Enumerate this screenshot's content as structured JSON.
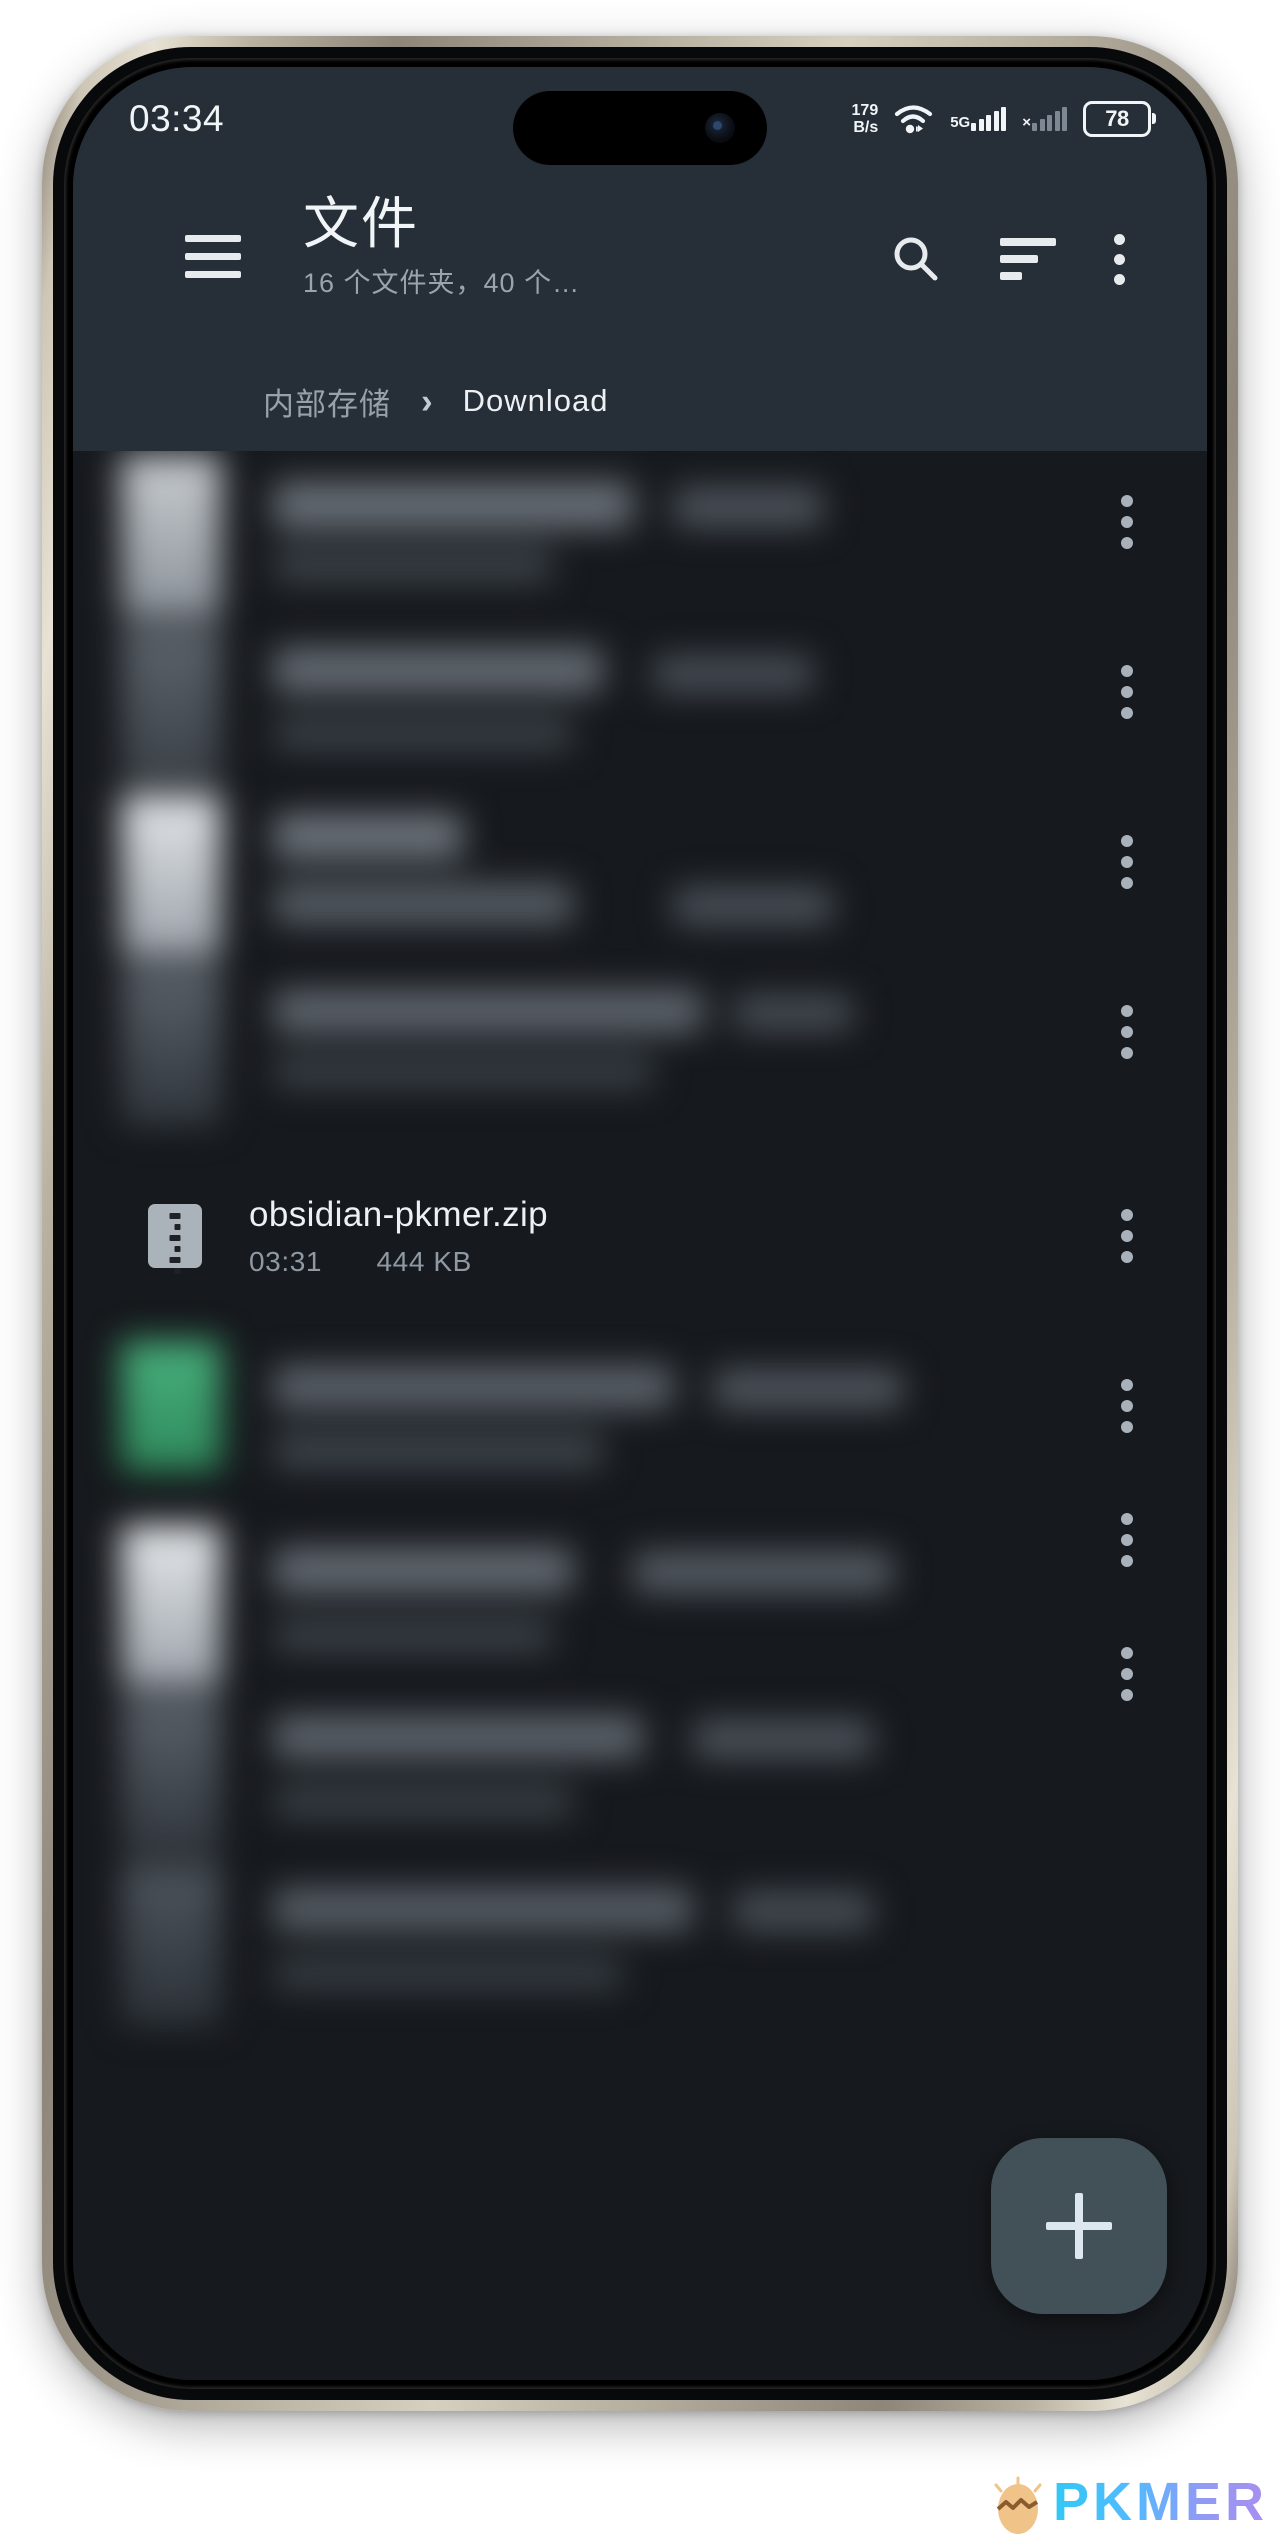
{
  "status_bar": {
    "clock": "03:34",
    "net_speed_value": "179",
    "net_speed_unit": "B/s",
    "wifi_icon": "wifi-icon",
    "sim1_label": "5G",
    "sim2_label": "×",
    "battery_level": "78"
  },
  "app_bar": {
    "menu_icon": "hamburger-menu-icon",
    "title": "文件",
    "subtitle": "16 个文件夹，40 个…",
    "search_icon": "search-icon",
    "sort_icon": "sort-icon",
    "overflow_icon": "more-vertical-icon"
  },
  "breadcrumb": {
    "root": "内部存储",
    "separator": "›",
    "current": "Download"
  },
  "file_list": {
    "visible_file": {
      "icon": "zip-file-icon",
      "name": "obsidian-pkmer.zip",
      "time": "03:31",
      "size": "444 KB",
      "menu_icon": "more-vertical-icon"
    },
    "blurred_rows_above": 4,
    "blurred_rows_below": 4,
    "accent_green": "#3d9c68"
  },
  "fab": {
    "icon": "plus-icon",
    "color": "#425058"
  },
  "watermark": {
    "text": "PKMER"
  },
  "theme": {
    "app_bar_bg": "#262e37",
    "content_bg": "#16191d",
    "text_primary": "#eef1f4",
    "text_secondary": "#8f99a2"
  }
}
